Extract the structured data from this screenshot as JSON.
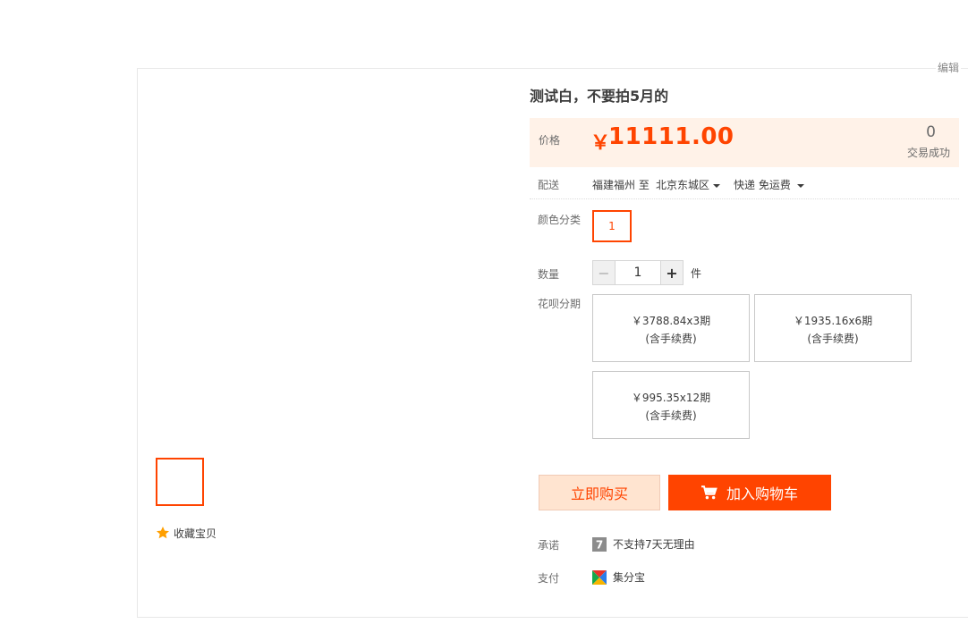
{
  "header": {
    "edit_label": "编辑"
  },
  "gallery": {
    "favorite_label": "收藏宝贝"
  },
  "product": {
    "title": "测试白，不要拍5月的",
    "price_label": "价格",
    "currency": "￥",
    "price": "11111.00",
    "sold_count": "0",
    "sold_label": "交易成功"
  },
  "shipping": {
    "label": "配送",
    "from": "福建福州 至",
    "to": "北京东城区",
    "method": "快递 免运费"
  },
  "sku": {
    "label": "颜色分类",
    "options": [
      "1"
    ]
  },
  "quantity": {
    "label": "数量",
    "value": "1",
    "unit": "件",
    "minus": "−",
    "plus": "+"
  },
  "installments": {
    "label": "花呗分期",
    "plans": [
      {
        "amount": "￥3788.84x3期",
        "note": "(含手续费)"
      },
      {
        "amount": "￥1935.16x6期",
        "note": "(含手续费)"
      },
      {
        "amount": "￥995.35x12期",
        "note": "(含手续费)"
      }
    ]
  },
  "actions": {
    "buy_now": "立即购买",
    "add_cart": "加入购物车"
  },
  "promise": {
    "label": "承诺",
    "badge": "7",
    "text": "不支持7天无理由"
  },
  "payment": {
    "label": "支付",
    "text": "集分宝"
  },
  "colors": {
    "accent": "#ff4400",
    "price_bg": "#fff2e8",
    "buy_now_bg": "#ffe4d0",
    "star": "#ff9f00"
  }
}
